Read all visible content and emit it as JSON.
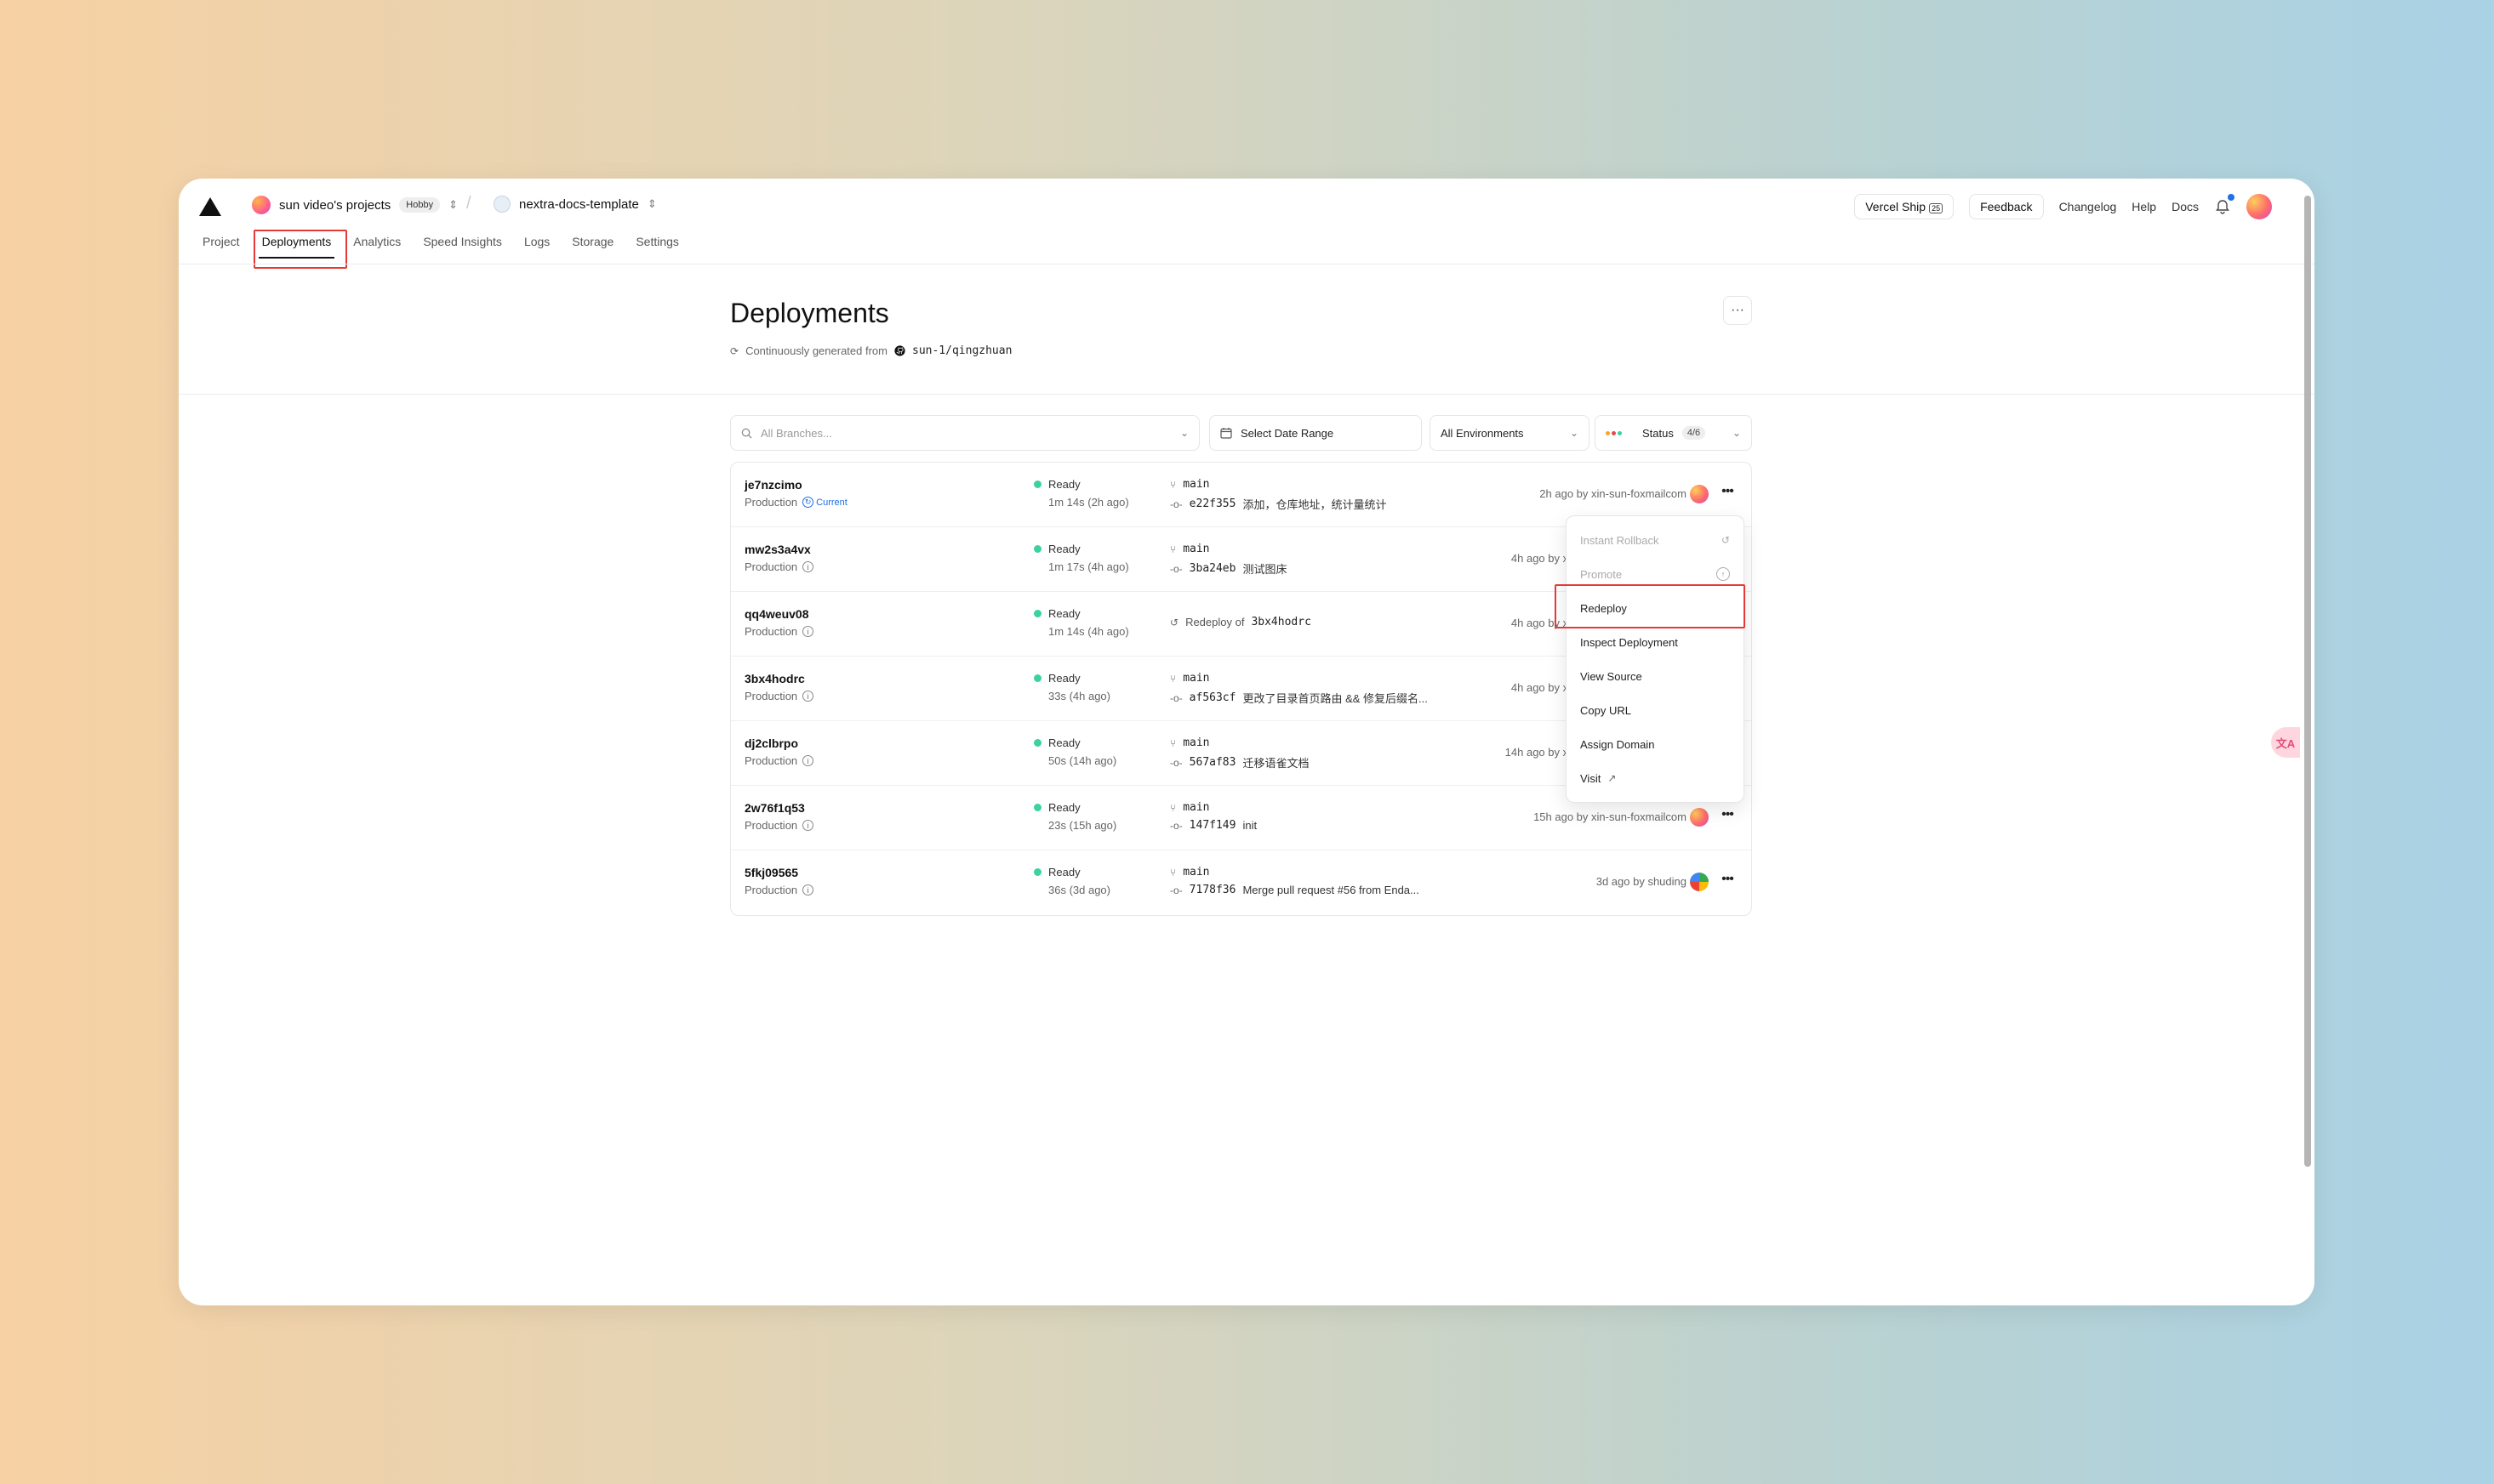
{
  "header": {
    "team_name": "sun video's projects",
    "team_badge": "Hobby",
    "project_name": "nextra-docs-template",
    "vercel_ship": "Vercel Ship",
    "vercel_ship_kbd": "25",
    "feedback": "Feedback",
    "changelog": "Changelog",
    "help": "Help",
    "docs": "Docs"
  },
  "tabs": [
    "Project",
    "Deployments",
    "Analytics",
    "Speed Insights",
    "Logs",
    "Storage",
    "Settings"
  ],
  "page": {
    "title": "Deployments",
    "subtitle_prefix": "Continuously generated from",
    "repo": "sun-1/qingzhuan",
    "more": "···"
  },
  "filters": {
    "branches_placeholder": "All Branches...",
    "date_range": "Select Date Range",
    "environments": "All Environments",
    "status": "Status",
    "status_count": "4/6"
  },
  "deployments": [
    {
      "id": "je7nzcimo",
      "env": "Production",
      "current": "Current",
      "status": "Ready",
      "duration": "1m 14s (2h ago)",
      "branch": "main",
      "commit": "e22f355",
      "message": "添加，仓库地址，统计量统计",
      "age": "2h ago by xin-sun-foxmailcom"
    },
    {
      "id": "mw2s3a4vx",
      "env": "Production",
      "status": "Ready",
      "duration": "1m 17s (4h ago)",
      "branch": "main",
      "commit": "3ba24eb",
      "message": "测试图床",
      "age": "4h ago by xi"
    },
    {
      "id": "qq4weuv08",
      "env": "Production",
      "status": "Ready",
      "duration": "1m 14s (4h ago)",
      "redeploy_prefix": "Redeploy of",
      "redeploy_of": "3bx4hodrc",
      "age": "4h ago by xi"
    },
    {
      "id": "3bx4hodrc",
      "env": "Production",
      "status": "Ready",
      "duration": "33s (4h ago)",
      "branch": "main",
      "commit": "af563cf",
      "message": "更改了目录首页路由 && 修复后缀名...",
      "age": "4h ago by xi"
    },
    {
      "id": "dj2clbrpo",
      "env": "Production",
      "status": "Ready",
      "duration": "50s (14h ago)",
      "branch": "main",
      "commit": "567af83",
      "message": "迁移语雀文档",
      "age": "14h ago by xi"
    },
    {
      "id": "2w76f1q53",
      "env": "Production",
      "status": "Ready",
      "duration": "23s (15h ago)",
      "branch": "main",
      "commit": "147f149",
      "message": "init",
      "age": "15h ago by xin-sun-foxmailcom"
    },
    {
      "id": "5fkj09565",
      "env": "Production",
      "status": "Ready",
      "duration": "36s (3d ago)",
      "branch": "main",
      "commit": "7178f36",
      "message": "Merge pull request #56 from Enda...",
      "age": "3d ago by shuding"
    }
  ],
  "menu": {
    "items": [
      "Instant Rollback",
      "Promote",
      "Redeploy",
      "Inspect Deployment",
      "View Source",
      "Copy URL",
      "Assign Domain",
      "Visit"
    ]
  },
  "translate_label": "文A",
  "colors": {
    "ready": "#3bd1a0",
    "highlight": "#e53935",
    "accent": "#1a6ee0"
  }
}
